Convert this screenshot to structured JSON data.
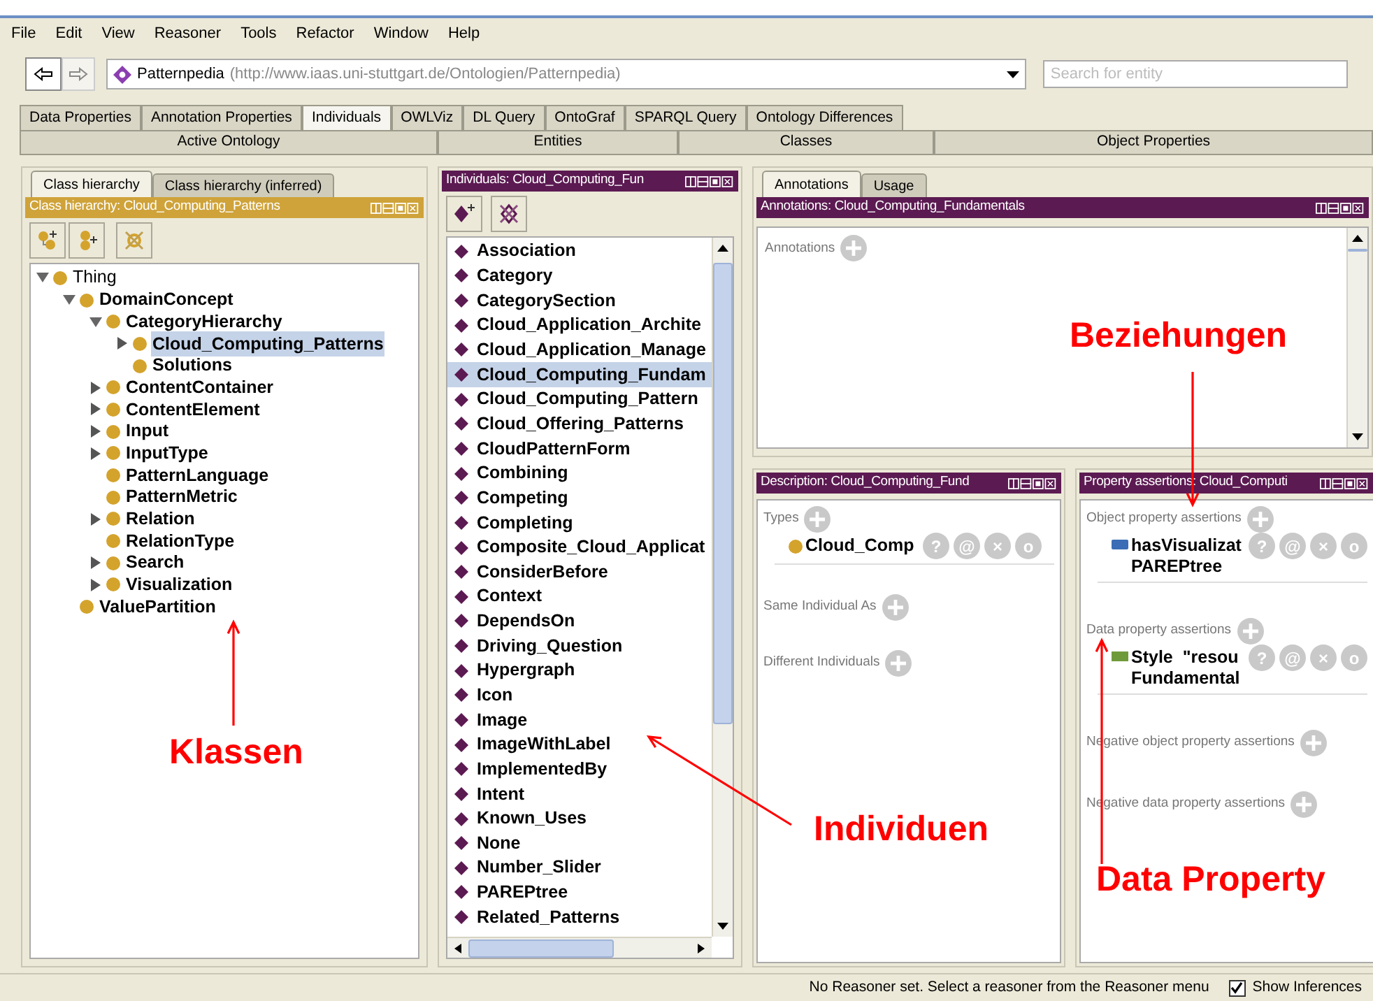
{
  "menu": [
    "File",
    "Edit",
    "View",
    "Reasoner",
    "Tools",
    "Refactor",
    "Window",
    "Help"
  ],
  "nav": {
    "ontology_name": "Patternpedia",
    "ontology_iri": "(http://www.iaas.uni-stuttgart.de/Ontologien/Patternpedia)",
    "search": {
      "placeholder": "Search for entity"
    }
  },
  "tabs": [
    {
      "label": "Data Properties",
      "selected": false
    },
    {
      "label": "Annotation Properties",
      "selected": false
    },
    {
      "label": "Individuals",
      "selected": true
    },
    {
      "label": "OWLViz",
      "selected": false
    },
    {
      "label": "DL Query",
      "selected": false
    },
    {
      "label": "OntoGraf",
      "selected": false
    },
    {
      "label": "SPARQL Query",
      "selected": false
    },
    {
      "label": "Ontology Differences",
      "selected": false
    }
  ],
  "views": [
    "Active Ontology",
    "Entities",
    "Classes",
    "Object Properties"
  ],
  "class_panel": {
    "tabs": [
      {
        "label": "Class hierarchy",
        "selected": true
      },
      {
        "label": "Class hierarchy (inferred)",
        "selected": false
      }
    ],
    "title": "Class hierarchy: Cloud_Computing_Patterns",
    "tree": [
      {
        "label": "Thing",
        "expandable": true,
        "expanded": true,
        "selected": false,
        "children": [
          {
            "label": "DomainConcept",
            "expandable": true,
            "expanded": true,
            "selected": false,
            "children": [
              {
                "label": "CategoryHierarchy",
                "expandable": true,
                "expanded": true,
                "selected": false,
                "children": [
                  {
                    "label": "Cloud_Computing_Patterns",
                    "expandable": true,
                    "expanded": false,
                    "selected": true
                  },
                  {
                    "label": "Solutions",
                    "expandable": false,
                    "selected": false
                  }
                ]
              },
              {
                "label": "ContentContainer",
                "expandable": true,
                "expanded": false,
                "selected": false
              },
              {
                "label": "ContentElement",
                "expandable": true,
                "expanded": false,
                "selected": false
              },
              {
                "label": "Input",
                "expandable": true,
                "expanded": false,
                "selected": false
              },
              {
                "label": "InputType",
                "expandable": true,
                "expanded": false,
                "selected": false
              },
              {
                "label": "PatternLanguage",
                "expandable": false,
                "selected": false
              },
              {
                "label": "PatternMetric",
                "expandable": false,
                "selected": false
              },
              {
                "label": "Relation",
                "expandable": true,
                "expanded": false,
                "selected": false
              },
              {
                "label": "RelationType",
                "expandable": false,
                "selected": false
              },
              {
                "label": "Search",
                "expandable": true,
                "expanded": false,
                "selected": false
              },
              {
                "label": "Visualization",
                "expandable": true,
                "expanded": false,
                "selected": false
              }
            ]
          },
          {
            "label": "ValuePartition",
            "expandable": false,
            "selected": false
          }
        ]
      }
    ]
  },
  "individuals_panel": {
    "title": "Individuals: Cloud_Computing_Fun",
    "items": [
      {
        "label": "Association",
        "selected": false
      },
      {
        "label": "Category",
        "selected": false
      },
      {
        "label": "CategorySection",
        "selected": false
      },
      {
        "label": "Cloud_Application_Archite",
        "selected": false
      },
      {
        "label": "Cloud_Application_Manage",
        "selected": false
      },
      {
        "label": "Cloud_Computing_Fundam",
        "selected": true
      },
      {
        "label": "Cloud_Computing_Pattern",
        "selected": false
      },
      {
        "label": "Cloud_Offering_Patterns",
        "selected": false
      },
      {
        "label": "CloudPatternForm",
        "selected": false
      },
      {
        "label": "Combining",
        "selected": false
      },
      {
        "label": "Competing",
        "selected": false
      },
      {
        "label": "Completing",
        "selected": false
      },
      {
        "label": "Composite_Cloud_Applicat",
        "selected": false
      },
      {
        "label": "ConsiderBefore",
        "selected": false
      },
      {
        "label": "Context",
        "selected": false
      },
      {
        "label": "DependsOn",
        "selected": false
      },
      {
        "label": "Driving_Question",
        "selected": false
      },
      {
        "label": "Hypergraph",
        "selected": false
      },
      {
        "label": "Icon",
        "selected": false
      },
      {
        "label": "Image",
        "selected": false
      },
      {
        "label": "ImageWithLabel",
        "selected": false
      },
      {
        "label": "ImplementedBy",
        "selected": false
      },
      {
        "label": "Intent",
        "selected": false
      },
      {
        "label": "Known_Uses",
        "selected": false
      },
      {
        "label": "None",
        "selected": false
      },
      {
        "label": "Number_Slider",
        "selected": false
      },
      {
        "label": "PAREPtree",
        "selected": false
      },
      {
        "label": "Related_Patterns",
        "selected": false
      }
    ]
  },
  "annotations_panel": {
    "tabs": [
      {
        "label": "Annotations",
        "selected": true
      },
      {
        "label": "Usage",
        "selected": false
      }
    ],
    "title": "Annotations: Cloud_Computing_Fundamentals",
    "section": "Annotations"
  },
  "description_panel": {
    "title": "Description: Cloud_Computing_Fund",
    "sections": [
      {
        "label": "Types",
        "entries": [
          {
            "kind": "class",
            "lines": [
              "Cloud_Comp"
            ],
            "actions": [
              "?",
              "@",
              "×",
              "o"
            ]
          }
        ]
      },
      {
        "label": "Same Individual As"
      },
      {
        "label": "Different Individuals"
      }
    ]
  },
  "property_panel": {
    "title": "Property assertions: Cloud_Computi",
    "sections": [
      {
        "label": "Object property assertions",
        "entries": [
          {
            "kind": "object_property",
            "lines": [
              "hasVisualizat",
              "PAREPtree"
            ],
            "actions": [
              "?",
              "@",
              "×",
              "o"
            ]
          }
        ]
      },
      {
        "label": "Data property assertions",
        "entries": [
          {
            "kind": "data_property",
            "lines": [
              "Style  \"resou",
              "Fundamental"
            ],
            "actions": [
              "?",
              "@",
              "×",
              "o"
            ]
          }
        ]
      },
      {
        "label": "Negative object property assertions"
      },
      {
        "label": "Negative data property assertions"
      }
    ]
  },
  "status": {
    "message": "No Reasoner set. Select a reasoner from the Reasoner menu",
    "show_inferences": {
      "label": "Show Inferences",
      "checked": true
    }
  },
  "callouts": [
    {
      "text": "Beziehungen"
    },
    {
      "text": "Klassen"
    },
    {
      "text": "Individuen"
    },
    {
      "text": "Data Property"
    }
  ]
}
